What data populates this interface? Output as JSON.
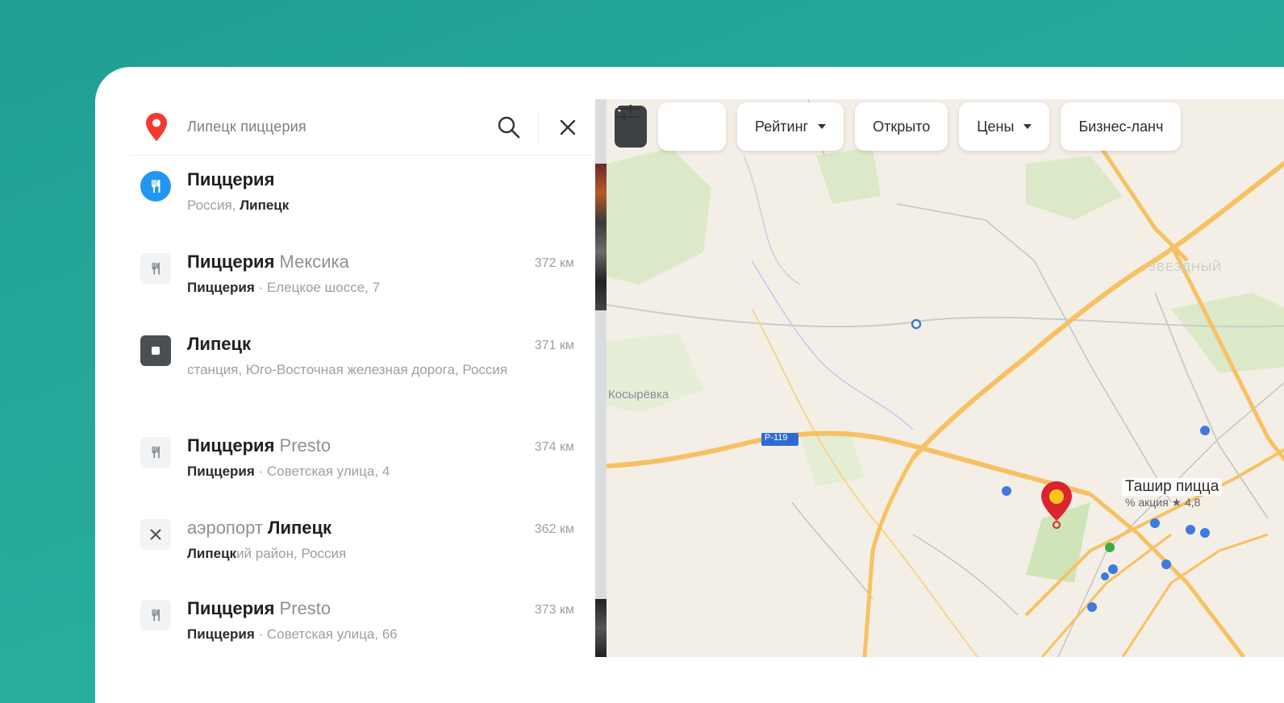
{
  "search": {
    "query": "Липецк пиццерия"
  },
  "results": [
    {
      "icon": "restaurant-icon",
      "title_bold": "Пиццерия",
      "title_rest": "",
      "sub_plain": "Россия, ",
      "sub_bold": "Липецк",
      "sub_after": "",
      "distance": ""
    },
    {
      "icon": "restaurant-icon",
      "title_bold": "Пиццерия",
      "title_rest": " Мексика",
      "sub_plain": "",
      "sub_bold": "Пиццерия",
      "sub_after": " · Елецкое шоссе, 7",
      "distance": "372 км"
    },
    {
      "icon": "station-icon",
      "title_bold": "Липецк",
      "title_rest": "",
      "sub_plain": "станция, Юго-Восточная железная дорога, Россия",
      "sub_bold": "",
      "sub_after": "",
      "distance": "371 км"
    },
    {
      "icon": "restaurant-icon",
      "title_bold": "Пиццерия",
      "title_rest": " Presto",
      "sub_plain": "",
      "sub_bold": "Пиццерия",
      "sub_after": " · Советская улица, 4",
      "distance": "374 км"
    },
    {
      "icon": "airport-icon",
      "title_bold": "Липецк",
      "title_pre": "аэропорт ",
      "title_rest": "",
      "sub_plain": "",
      "sub_bold": "Липецк",
      "sub_after": "ий район, Россия",
      "distance": "362 км"
    },
    {
      "icon": "restaurant-icon",
      "title_bold": "Пиццерия",
      "title_rest": " Presto",
      "sub_plain": "",
      "sub_bold": "Пиццерия",
      "sub_after": " · Советская улица, 66",
      "distance": "373 км"
    }
  ],
  "filters": {
    "rating": "Рейтинг",
    "open": "Открыто",
    "prices": "Цены",
    "business_lunch": "Бизнес-ланч"
  },
  "map": {
    "labels": {
      "kosyrevka": "Косырёвка",
      "zvezdny": "ЗВЕЗДНЫЙ",
      "road_r119": "Р-119"
    },
    "poi": {
      "title": "Ташир пицца",
      "meta": "% акция  ★ 4,8"
    }
  },
  "colors": {
    "accent_blue": "#2196f3",
    "brand_red": "#f43a2f",
    "road_orange": "#f7c163"
  }
}
